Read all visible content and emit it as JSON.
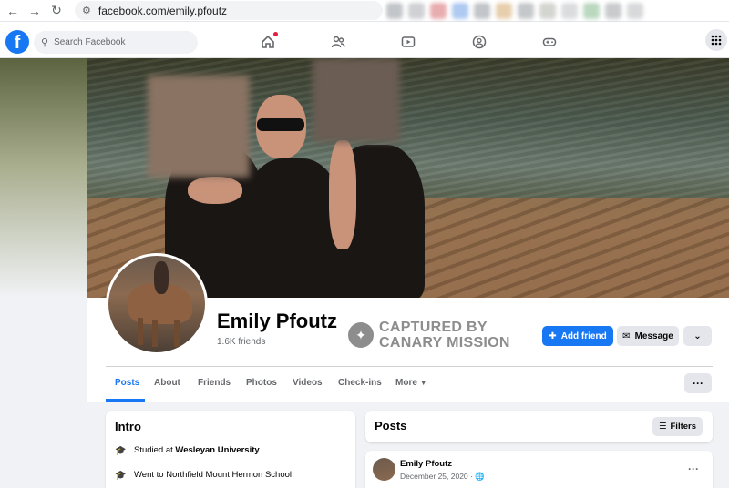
{
  "browser": {
    "url": "facebook.com/emily.pfoutz"
  },
  "nav": {
    "search_placeholder": "Search Facebook"
  },
  "profile": {
    "name": "Emily Pfoutz",
    "friends": "1.6K friends",
    "watermark_line1": "CAPTURED BY",
    "watermark_line2": "CANARY MISSION",
    "add_friend_label": "Add friend",
    "message_label": "Message"
  },
  "tabs": {
    "items": [
      "Posts",
      "About",
      "Friends",
      "Photos",
      "Videos",
      "Check-ins",
      "More"
    ],
    "active": "Posts"
  },
  "intro": {
    "title": "Intro",
    "rows": [
      {
        "prefix": "Studied at ",
        "bold": "Wesleyan University"
      },
      {
        "text": "Went to Northfield Mount Hermon School"
      }
    ]
  },
  "posts": {
    "title": "Posts",
    "filters_label": "Filters",
    "first_post": {
      "author": "Emily Pfoutz",
      "date": "December 25, 2020 · "
    }
  },
  "colors": {
    "brand": "#1877f2",
    "background": "#f0f2f5",
    "notification": "#e41e3f"
  }
}
